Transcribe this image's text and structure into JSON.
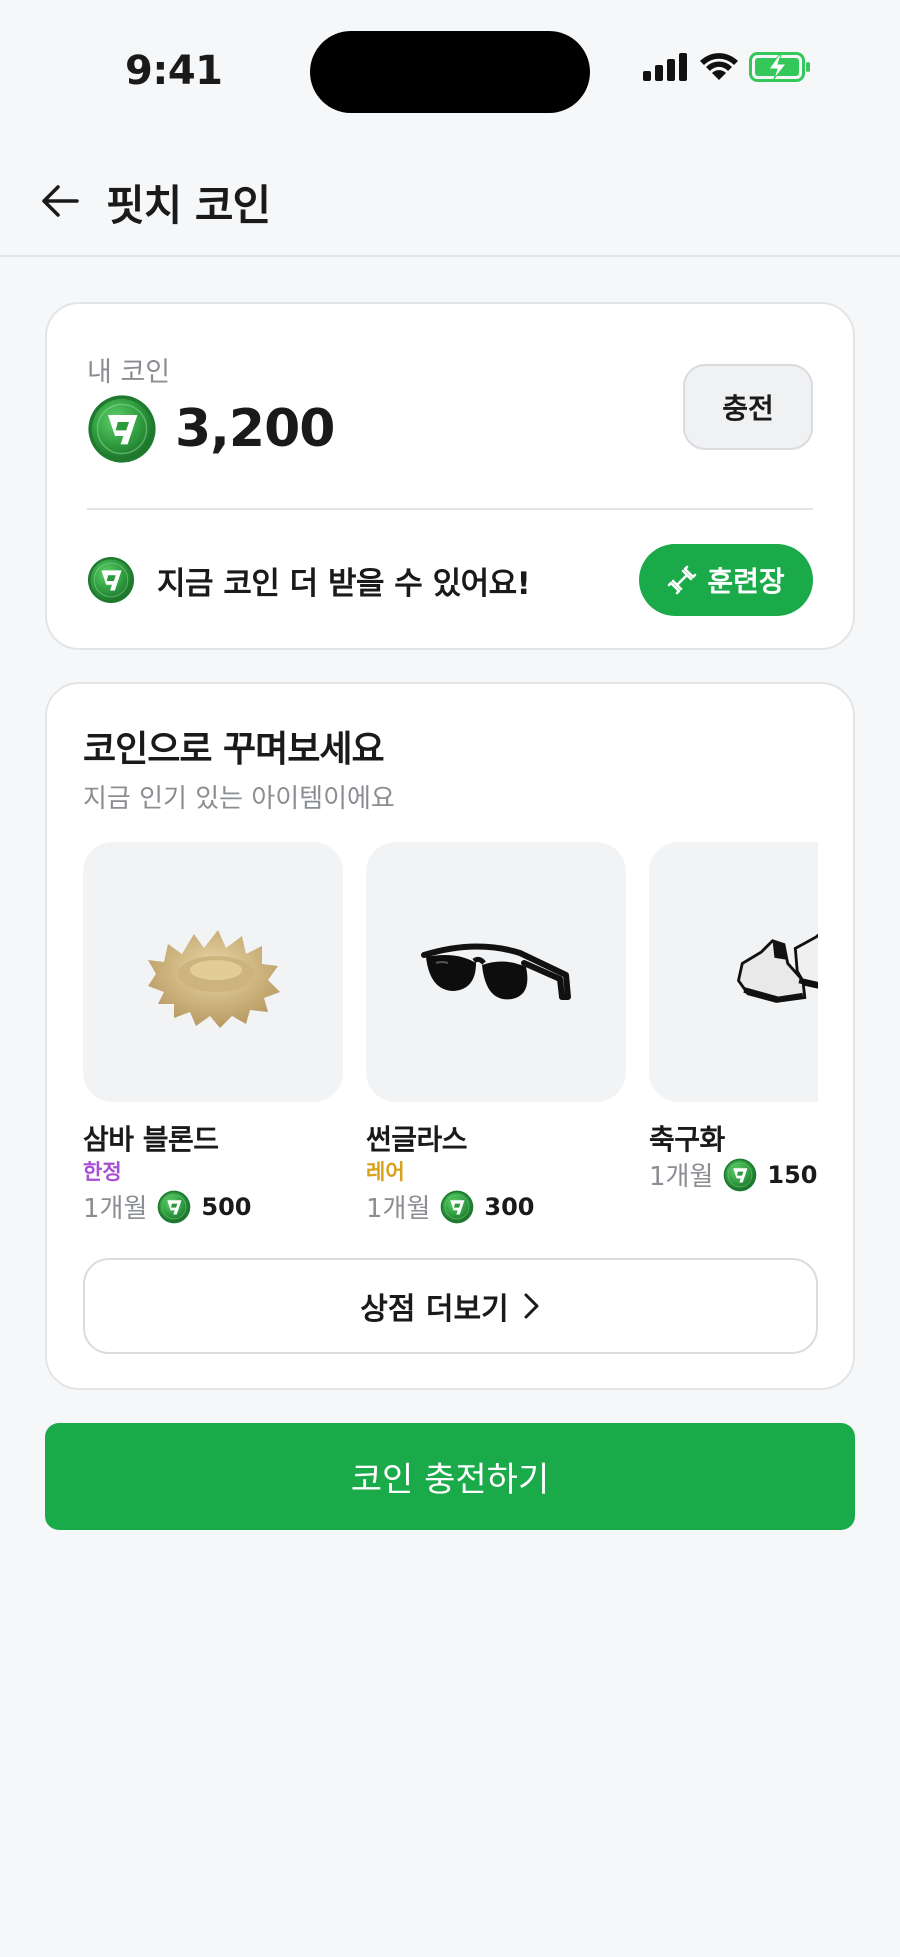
{
  "status_bar": {
    "time": "9:41"
  },
  "header": {
    "title": "핏치 코인"
  },
  "wallet": {
    "label": "내 코인",
    "balance": "3,200",
    "charge_label": "충전",
    "promo_text": "지금 코인 더 받을 수 있어요!",
    "training_label": "훈련장"
  },
  "shop": {
    "title": "코인으로 꾸며보세요",
    "subtitle": "지금 인기 있는 아이템이에요",
    "items": [
      {
        "name": "삼바 블론드",
        "badge": "한정",
        "badge_color": "#a94fd6",
        "period": "1개월",
        "price": "500"
      },
      {
        "name": "썬글라스",
        "badge": "레어",
        "badge_color": "#d7a21a",
        "period": "1개월",
        "price": "300"
      },
      {
        "name": "축구화",
        "badge": "",
        "period": "1개월",
        "price": "150"
      }
    ],
    "more_label": "상점 더보기"
  },
  "cta": {
    "label": "코인 충전하기"
  },
  "colors": {
    "accent": "#1aaa4a",
    "coin": "#2f9a3f"
  }
}
